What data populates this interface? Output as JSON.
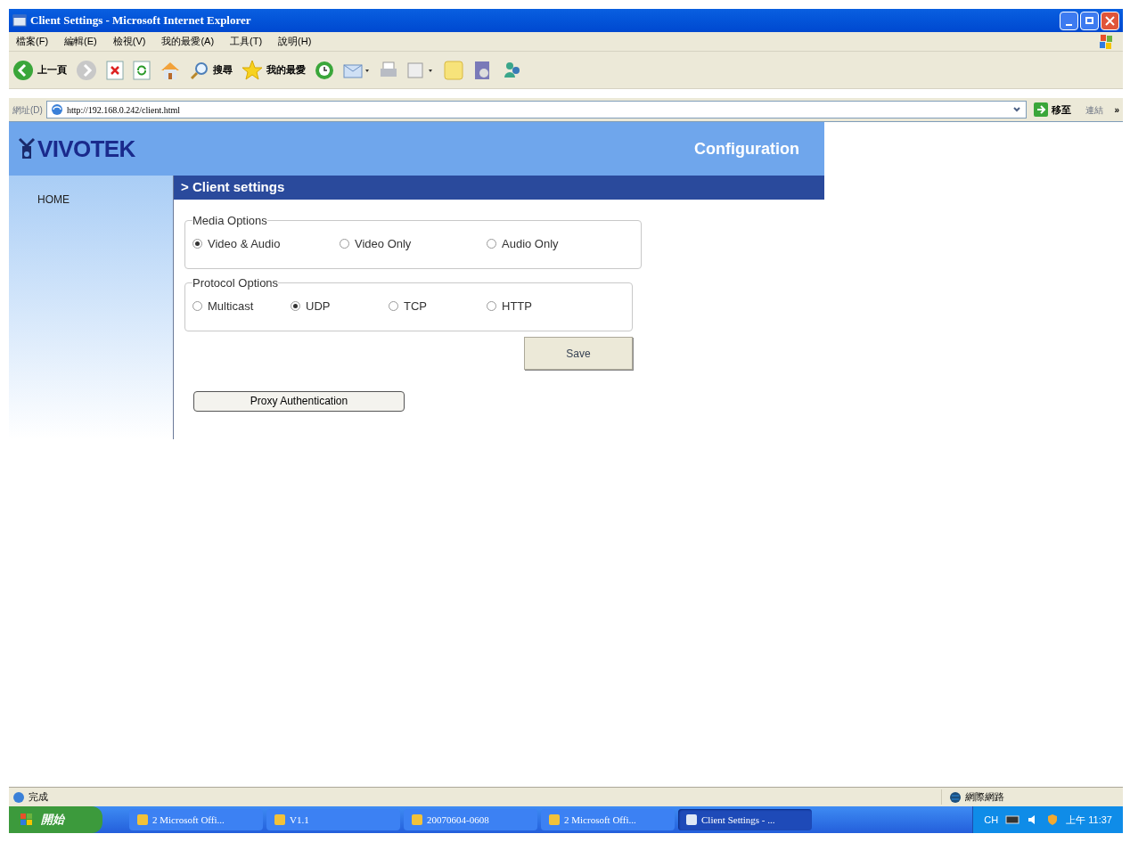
{
  "window": {
    "title": "Client Settings - Microsoft Internet Explorer"
  },
  "menu": [
    "檔案(F)",
    "編輯(E)",
    "檢視(V)",
    "我的最愛(A)",
    "工具(T)",
    "說明(H)"
  ],
  "toolbar": [
    {
      "kind": "back",
      "label": "上一頁"
    },
    {
      "kind": "forward"
    },
    {
      "kind": "stop"
    },
    {
      "kind": "refresh"
    },
    {
      "kind": "home"
    },
    {
      "kind": "search",
      "label": "搜尋"
    },
    {
      "kind": "favorites",
      "label": "我的最愛"
    },
    {
      "kind": "history"
    },
    {
      "kind": "mail"
    },
    {
      "kind": "print"
    },
    {
      "kind": "edit"
    },
    {
      "kind": "folder"
    },
    {
      "kind": "research"
    },
    {
      "kind": "messenger"
    }
  ],
  "address": {
    "label": "網址(D)",
    "value": "http://192.168.0.242/client.html",
    "go": "移至",
    "links": "連結",
    "more": "»"
  },
  "page": {
    "logo": "VIVOTEK",
    "header": "Configuration",
    "sidebar": [
      "HOME"
    ],
    "section": "> Client settings",
    "groups": [
      {
        "title": "Media Options",
        "options": [
          {
            "label": "Video & Audio",
            "selected": true
          },
          {
            "label": "Video Only",
            "selected": false
          },
          {
            "label": "Audio Only",
            "selected": false
          }
        ]
      },
      {
        "title": "Protocol Options",
        "options": [
          {
            "label": "Multicast",
            "selected": false
          },
          {
            "label": "UDP",
            "selected": true
          },
          {
            "label": "TCP",
            "selected": false
          },
          {
            "label": "HTTP",
            "selected": false
          }
        ]
      }
    ],
    "save": "Save",
    "proxy": "Proxy Authentication"
  },
  "status_bar": {
    "text": "完成",
    "zone": "網際網路"
  },
  "taskbar": {
    "start": "開始",
    "tasks": [
      {
        "label": "2 Microsoft Offi...",
        "selected": false
      },
      {
        "label": "V1.1",
        "selected": false
      },
      {
        "label": "20070604-0608",
        "selected": false
      },
      {
        "label": "2 Microsoft Offi...",
        "selected": false
      },
      {
        "label": "Client Settings - ...",
        "selected": true
      }
    ],
    "language": "CH",
    "clock": "上午 11:37"
  }
}
